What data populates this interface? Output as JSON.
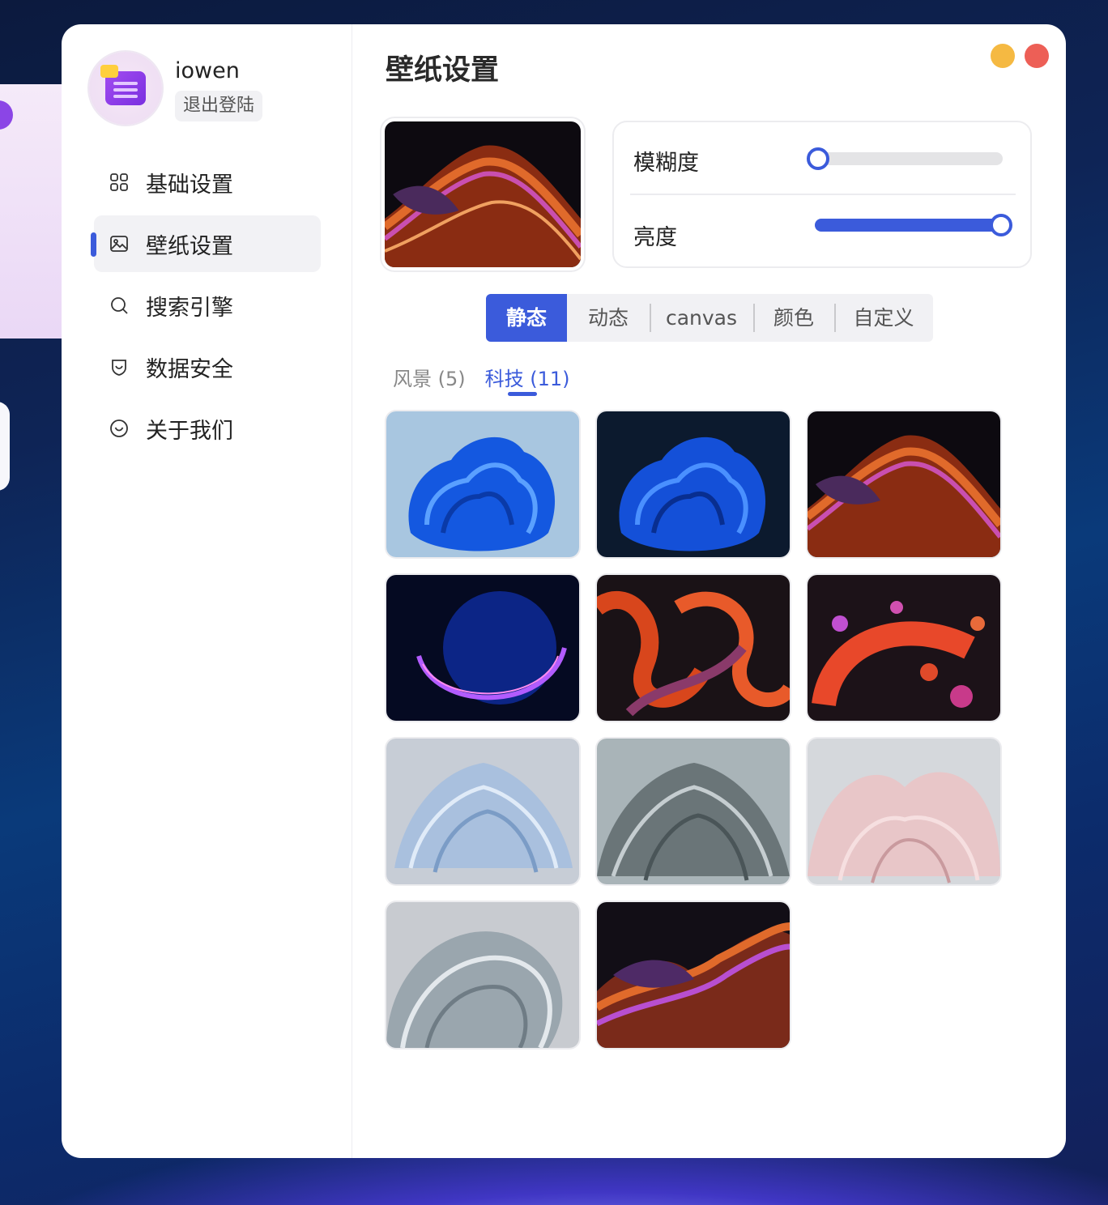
{
  "user": {
    "name": "iowen",
    "logout_label": "退出登陆"
  },
  "sidebar": {
    "items": [
      {
        "label": "基础设置",
        "icon": "grid-icon",
        "active": false
      },
      {
        "label": "壁纸设置",
        "icon": "image-icon",
        "active": true
      },
      {
        "label": "搜索引擎",
        "icon": "search-icon",
        "active": false
      },
      {
        "label": "数据安全",
        "icon": "shield-icon",
        "active": false
      },
      {
        "label": "关于我们",
        "icon": "smile-icon",
        "active": false
      }
    ]
  },
  "page": {
    "title": "壁纸设置"
  },
  "window_controls": {
    "minimize_color": "#f5b942",
    "close_color": "#ed5f56"
  },
  "sliders": {
    "blur": {
      "label": "模糊度",
      "value": 0
    },
    "brightness": {
      "label": "亮度",
      "value": 1
    }
  },
  "tabs": [
    {
      "label": "静态",
      "active": true
    },
    {
      "label": "动态",
      "active": false
    },
    {
      "label": "canvas",
      "active": false
    },
    {
      "label": "颜色",
      "active": false
    },
    {
      "label": "自定义",
      "active": false
    }
  ],
  "categories": [
    {
      "label": "风景 (5)",
      "active": false
    },
    {
      "label": "科技 (11)",
      "active": true
    }
  ],
  "wallpapers": [
    "blue-bloom-light",
    "blue-bloom-dark",
    "red-flow-dark",
    "blue-glow-orb",
    "red-ribbons",
    "red-bubbles",
    "light-blue-bloom",
    "gray-bloom",
    "pink-bloom",
    "silver-swirl",
    "purple-flow-dark"
  ],
  "accent_color": "#3b5bdb"
}
